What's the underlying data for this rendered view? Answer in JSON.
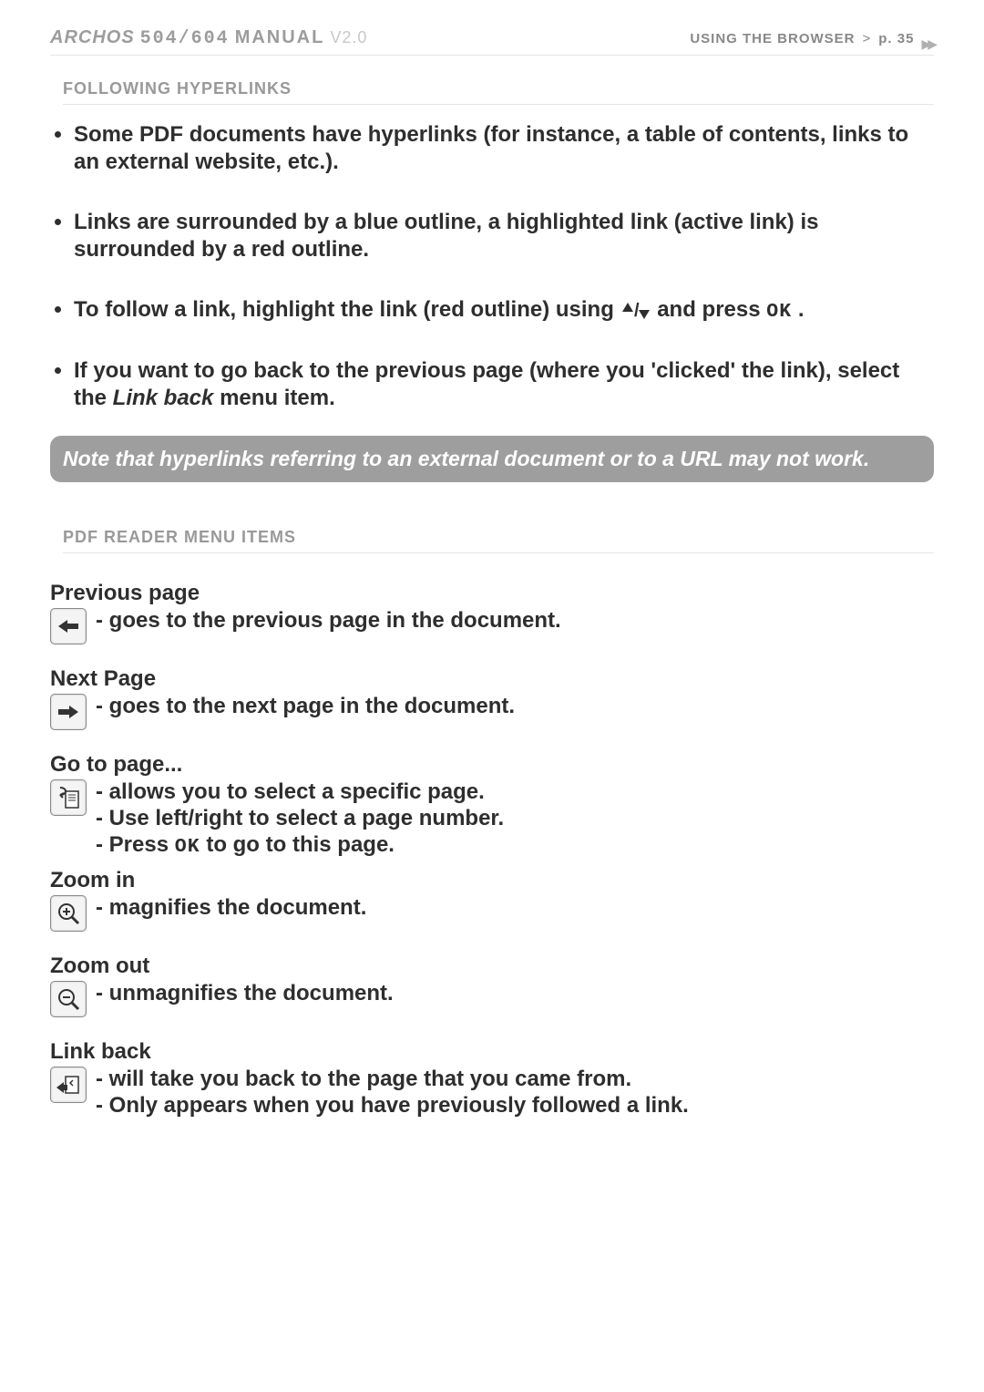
{
  "header": {
    "brand": "ARCHOS",
    "model": "504/604",
    "manual": "MANUAL",
    "version": "V2.0",
    "section": "USING THE BROWSER",
    "chevron": ">",
    "page_label": "p. 35"
  },
  "sections": {
    "hyperlinks_title": "FOLLOWING HYPERLINKS",
    "menu_items_title": "PDF READER MENU ITEMS"
  },
  "bullets": {
    "b1": "Some PDF documents have hyperlinks (for instance, a table of contents, links to an external website, etc.).",
    "b2": "Links are surrounded by a blue outline, a highlighted link (active link) is surrounded by a red outline.",
    "b3_pre": "To follow a link, highlight the link (red outline) using ",
    "b3_mid": " and press ",
    "b3_ok": "OK",
    "b3_post": ".",
    "b4_pre": "If you want to go back to the previous page (where you 'clicked' the link), select the ",
    "b4_italic": "Link back",
    "b4_post": " menu item."
  },
  "note": "Note that hyperlinks referring to an external document or to a URL may not work.",
  "menu": {
    "prev": {
      "title": "Previous page",
      "l1": "goes to the previous page in the document."
    },
    "next": {
      "title": "Next Page",
      "l1": "goes to the next page in the document."
    },
    "goto": {
      "title": "Go to page...",
      "l1": "allows you to select a specific page.",
      "l2": "Use left/right to select a page number.",
      "l3_pre": "Press ",
      "l3_ok": "OK",
      "l3_post": " to go to this page."
    },
    "zoomin": {
      "title": "Zoom in",
      "l1": "magnifies the document."
    },
    "zoomout": {
      "title": "Zoom out",
      "l1": "unmagnifies the document."
    },
    "linkback": {
      "title": "Link back",
      "l1": "will take you back to the page that you came from.",
      "l2": "Only appears when you have previously followed a link."
    }
  }
}
